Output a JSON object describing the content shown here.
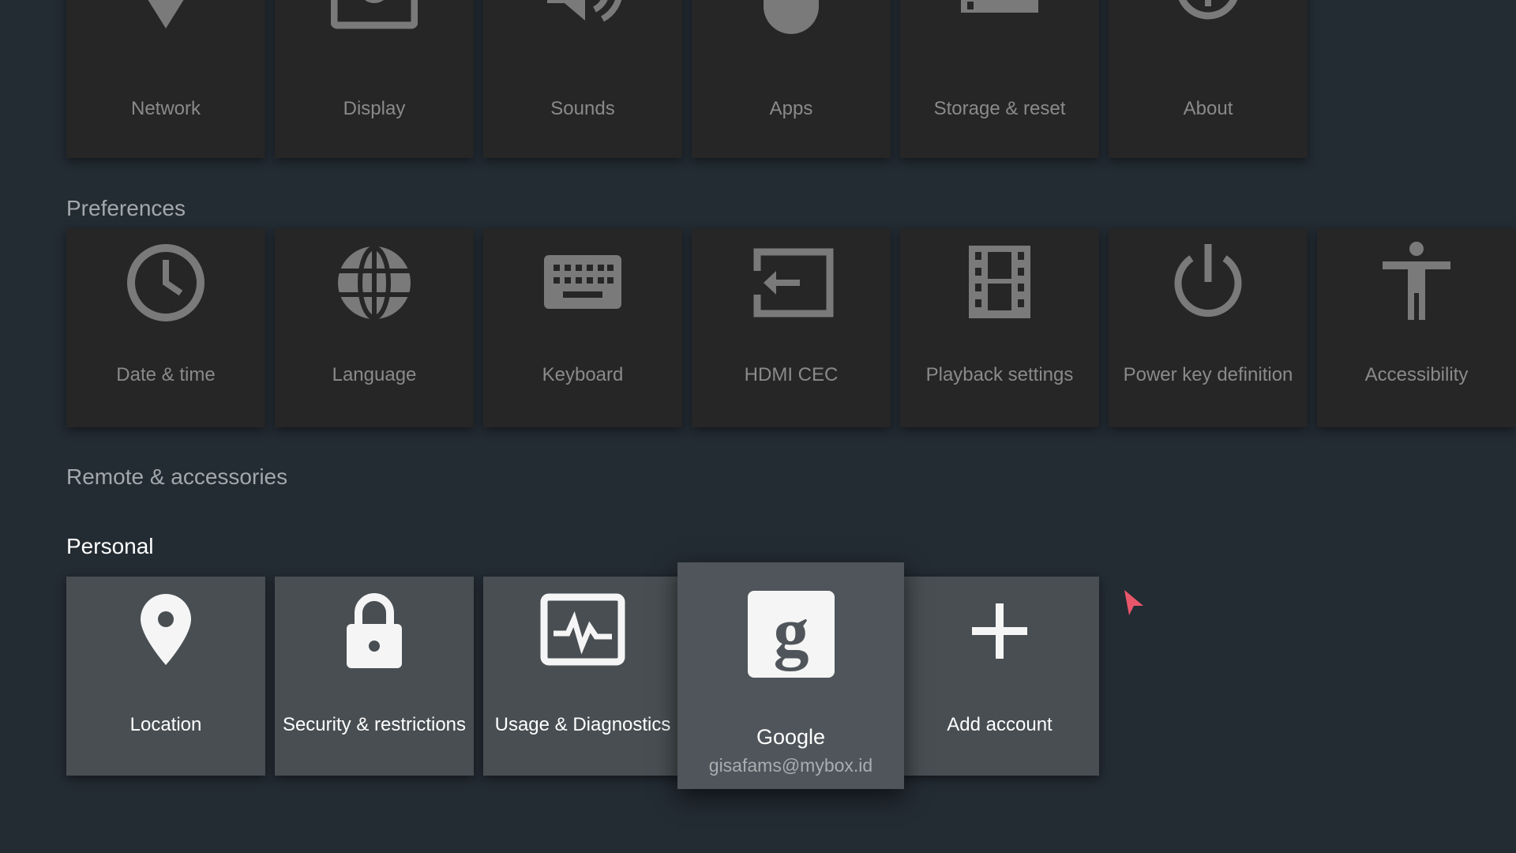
{
  "colors": {
    "background": "#232b33",
    "tile": "#262626",
    "tile_active": "#484e52",
    "icon_dim": "#7a7a7a",
    "icon_active": "#f5f5f5",
    "cursor": "#e9566a"
  },
  "device": {
    "items": [
      {
        "label": "Network",
        "icon": "wifi-icon"
      },
      {
        "label": "Display",
        "icon": "display-icon"
      },
      {
        "label": "Sounds",
        "icon": "speaker-icon"
      },
      {
        "label": "Apps",
        "icon": "android-icon"
      },
      {
        "label": "Storage & reset",
        "icon": "storage-icon"
      },
      {
        "label": "About",
        "icon": "info-icon"
      }
    ]
  },
  "preferences": {
    "title": "Preferences",
    "items": [
      {
        "label": "Date & time",
        "icon": "clock-icon"
      },
      {
        "label": "Language",
        "icon": "globe-icon"
      },
      {
        "label": "Keyboard",
        "icon": "keyboard-icon"
      },
      {
        "label": "HDMI CEC",
        "icon": "hdmi-input-icon"
      },
      {
        "label": "Playback settings",
        "icon": "film-icon"
      },
      {
        "label": "Power key definition",
        "icon": "power-icon"
      },
      {
        "label": "Accessibility",
        "icon": "accessibility-icon"
      }
    ]
  },
  "remote": {
    "title": "Remote & accessories"
  },
  "personal": {
    "title": "Personal",
    "items": [
      {
        "label": "Location",
        "icon": "location-pin-icon"
      },
      {
        "label": "Security & restrictions",
        "icon": "lock-icon"
      },
      {
        "label": "Usage & Diagnostics",
        "icon": "diagnostics-icon"
      },
      {
        "label": "Google",
        "sublabel": "gisafams@mybox.id",
        "icon": "google-g-icon",
        "focused": true
      },
      {
        "label": "Add account",
        "icon": "plus-icon"
      }
    ]
  }
}
